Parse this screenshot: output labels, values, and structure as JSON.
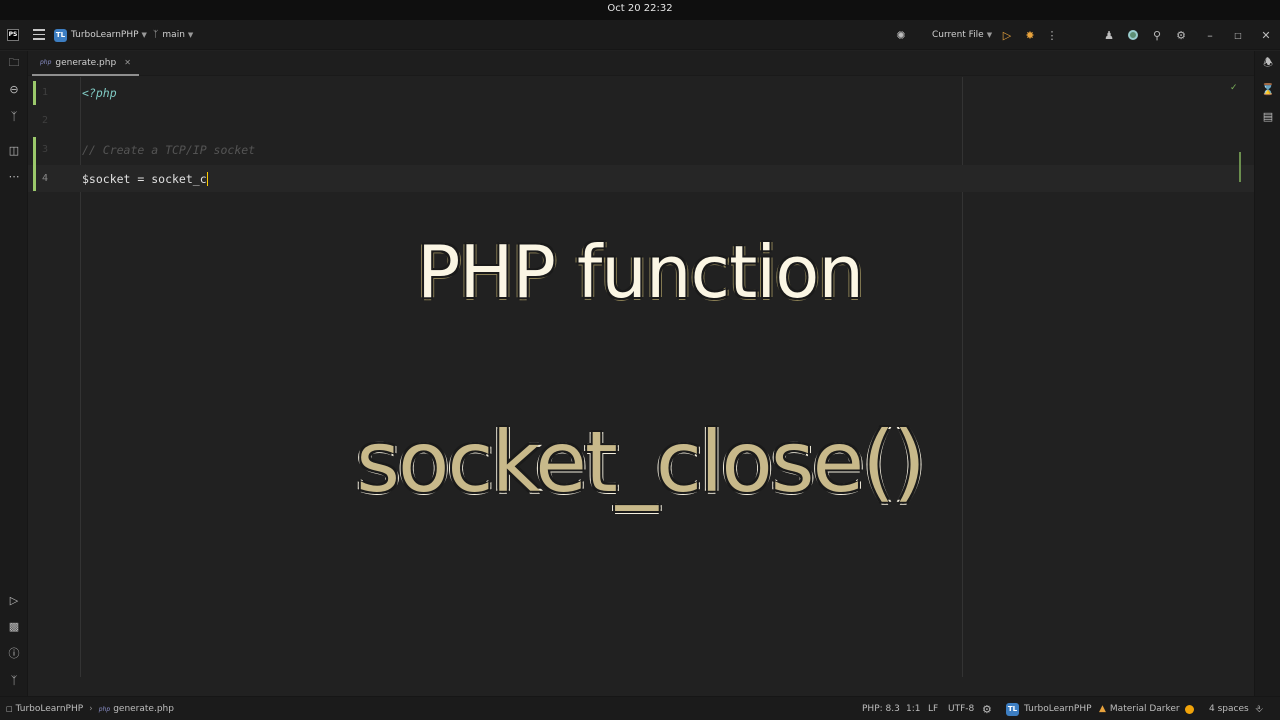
{
  "os": {
    "clock": "Oct 20  22:32"
  },
  "toolbar": {
    "project_badge": "TL",
    "project_name": "TurboLearnPHP",
    "branch": "main",
    "run_config": "Current File"
  },
  "tabs": [
    {
      "icon_text": "php",
      "label": "generate.php"
    }
  ],
  "editor": {
    "lines": [
      {
        "number": "1",
        "text": "<?php"
      },
      {
        "number": "2",
        "text": ""
      },
      {
        "number": "3",
        "text": "// Create a TCP/IP socket"
      },
      {
        "number": "4",
        "text": "$socket = socket_c"
      }
    ]
  },
  "overlay": {
    "line1": "PHP function",
    "line2": "socket_close()"
  },
  "status_bar": {
    "breadcrumb_project": "TurboLearnPHP",
    "breadcrumb_php_icon": "php",
    "breadcrumb_file": "generate.php",
    "php_version": "PHP: 8.3",
    "cursor_position": "1:1",
    "line_separator": "LF",
    "encoding": "UTF-8",
    "project_badge": "TL",
    "project_name": "TurboLearnPHP",
    "theme": "Material Darker",
    "indent": "4 spaces"
  },
  "colors": {
    "accent_green": "#9bc96b",
    "caret": "#ffcc00",
    "project_badge": "#3d7ec2",
    "status_dot": "#f0a30a"
  }
}
